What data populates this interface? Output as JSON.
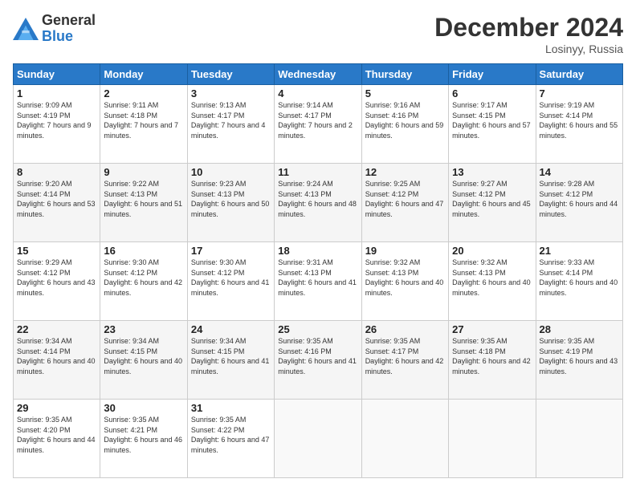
{
  "header": {
    "logo_general": "General",
    "logo_blue": "Blue",
    "month_title": "December 2024",
    "location": "Losinyy, Russia"
  },
  "weekdays": [
    "Sunday",
    "Monday",
    "Tuesday",
    "Wednesday",
    "Thursday",
    "Friday",
    "Saturday"
  ],
  "weeks": [
    [
      {
        "day": "1",
        "sunrise": "Sunrise: 9:09 AM",
        "sunset": "Sunset: 4:19 PM",
        "daylight": "Daylight: 7 hours and 9 minutes."
      },
      {
        "day": "2",
        "sunrise": "Sunrise: 9:11 AM",
        "sunset": "Sunset: 4:18 PM",
        "daylight": "Daylight: 7 hours and 7 minutes."
      },
      {
        "day": "3",
        "sunrise": "Sunrise: 9:13 AM",
        "sunset": "Sunset: 4:17 PM",
        "daylight": "Daylight: 7 hours and 4 minutes."
      },
      {
        "day": "4",
        "sunrise": "Sunrise: 9:14 AM",
        "sunset": "Sunset: 4:17 PM",
        "daylight": "Daylight: 7 hours and 2 minutes."
      },
      {
        "day": "5",
        "sunrise": "Sunrise: 9:16 AM",
        "sunset": "Sunset: 4:16 PM",
        "daylight": "Daylight: 6 hours and 59 minutes."
      },
      {
        "day": "6",
        "sunrise": "Sunrise: 9:17 AM",
        "sunset": "Sunset: 4:15 PM",
        "daylight": "Daylight: 6 hours and 57 minutes."
      },
      {
        "day": "7",
        "sunrise": "Sunrise: 9:19 AM",
        "sunset": "Sunset: 4:14 PM",
        "daylight": "Daylight: 6 hours and 55 minutes."
      }
    ],
    [
      {
        "day": "8",
        "sunrise": "Sunrise: 9:20 AM",
        "sunset": "Sunset: 4:14 PM",
        "daylight": "Daylight: 6 hours and 53 minutes."
      },
      {
        "day": "9",
        "sunrise": "Sunrise: 9:22 AM",
        "sunset": "Sunset: 4:13 PM",
        "daylight": "Daylight: 6 hours and 51 minutes."
      },
      {
        "day": "10",
        "sunrise": "Sunrise: 9:23 AM",
        "sunset": "Sunset: 4:13 PM",
        "daylight": "Daylight: 6 hours and 50 minutes."
      },
      {
        "day": "11",
        "sunrise": "Sunrise: 9:24 AM",
        "sunset": "Sunset: 4:13 PM",
        "daylight": "Daylight: 6 hours and 48 minutes."
      },
      {
        "day": "12",
        "sunrise": "Sunrise: 9:25 AM",
        "sunset": "Sunset: 4:12 PM",
        "daylight": "Daylight: 6 hours and 47 minutes."
      },
      {
        "day": "13",
        "sunrise": "Sunrise: 9:27 AM",
        "sunset": "Sunset: 4:12 PM",
        "daylight": "Daylight: 6 hours and 45 minutes."
      },
      {
        "day": "14",
        "sunrise": "Sunrise: 9:28 AM",
        "sunset": "Sunset: 4:12 PM",
        "daylight": "Daylight: 6 hours and 44 minutes."
      }
    ],
    [
      {
        "day": "15",
        "sunrise": "Sunrise: 9:29 AM",
        "sunset": "Sunset: 4:12 PM",
        "daylight": "Daylight: 6 hours and 43 minutes."
      },
      {
        "day": "16",
        "sunrise": "Sunrise: 9:30 AM",
        "sunset": "Sunset: 4:12 PM",
        "daylight": "Daylight: 6 hours and 42 minutes."
      },
      {
        "day": "17",
        "sunrise": "Sunrise: 9:30 AM",
        "sunset": "Sunset: 4:12 PM",
        "daylight": "Daylight: 6 hours and 41 minutes."
      },
      {
        "day": "18",
        "sunrise": "Sunrise: 9:31 AM",
        "sunset": "Sunset: 4:13 PM",
        "daylight": "Daylight: 6 hours and 41 minutes."
      },
      {
        "day": "19",
        "sunrise": "Sunrise: 9:32 AM",
        "sunset": "Sunset: 4:13 PM",
        "daylight": "Daylight: 6 hours and 40 minutes."
      },
      {
        "day": "20",
        "sunrise": "Sunrise: 9:32 AM",
        "sunset": "Sunset: 4:13 PM",
        "daylight": "Daylight: 6 hours and 40 minutes."
      },
      {
        "day": "21",
        "sunrise": "Sunrise: 9:33 AM",
        "sunset": "Sunset: 4:14 PM",
        "daylight": "Daylight: 6 hours and 40 minutes."
      }
    ],
    [
      {
        "day": "22",
        "sunrise": "Sunrise: 9:34 AM",
        "sunset": "Sunset: 4:14 PM",
        "daylight": "Daylight: 6 hours and 40 minutes."
      },
      {
        "day": "23",
        "sunrise": "Sunrise: 9:34 AM",
        "sunset": "Sunset: 4:15 PM",
        "daylight": "Daylight: 6 hours and 40 minutes."
      },
      {
        "day": "24",
        "sunrise": "Sunrise: 9:34 AM",
        "sunset": "Sunset: 4:15 PM",
        "daylight": "Daylight: 6 hours and 41 minutes."
      },
      {
        "day": "25",
        "sunrise": "Sunrise: 9:35 AM",
        "sunset": "Sunset: 4:16 PM",
        "daylight": "Daylight: 6 hours and 41 minutes."
      },
      {
        "day": "26",
        "sunrise": "Sunrise: 9:35 AM",
        "sunset": "Sunset: 4:17 PM",
        "daylight": "Daylight: 6 hours and 42 minutes."
      },
      {
        "day": "27",
        "sunrise": "Sunrise: 9:35 AM",
        "sunset": "Sunset: 4:18 PM",
        "daylight": "Daylight: 6 hours and 42 minutes."
      },
      {
        "day": "28",
        "sunrise": "Sunrise: 9:35 AM",
        "sunset": "Sunset: 4:19 PM",
        "daylight": "Daylight: 6 hours and 43 minutes."
      }
    ],
    [
      {
        "day": "29",
        "sunrise": "Sunrise: 9:35 AM",
        "sunset": "Sunset: 4:20 PM",
        "daylight": "Daylight: 6 hours and 44 minutes."
      },
      {
        "day": "30",
        "sunrise": "Sunrise: 9:35 AM",
        "sunset": "Sunset: 4:21 PM",
        "daylight": "Daylight: 6 hours and 46 minutes."
      },
      {
        "day": "31",
        "sunrise": "Sunrise: 9:35 AM",
        "sunset": "Sunset: 4:22 PM",
        "daylight": "Daylight: 6 hours and 47 minutes."
      },
      null,
      null,
      null,
      null
    ]
  ]
}
